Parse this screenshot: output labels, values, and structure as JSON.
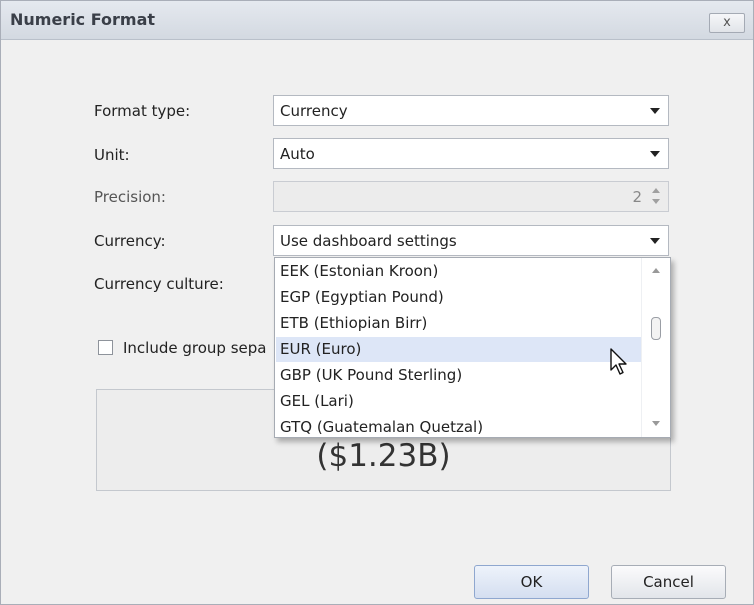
{
  "window": {
    "title": "Numeric Format",
    "close_glyph": "x"
  },
  "form": {
    "format_type": {
      "label": "Format type:",
      "value": "Currency"
    },
    "unit": {
      "label": "Unit:",
      "value": "Auto"
    },
    "precision": {
      "label": "Precision:",
      "value": "2",
      "disabled": true
    },
    "currency": {
      "label": "Currency:",
      "value": "Use dashboard settings"
    },
    "currency_culture": {
      "label": "Currency culture:"
    },
    "group_separator": {
      "label": "Include group sepa",
      "checked": false
    }
  },
  "dropdown": {
    "items": [
      {
        "label": "EEK (Estonian Kroon)"
      },
      {
        "label": "EGP (Egyptian Pound)"
      },
      {
        "label": "ETB (Ethiopian Birr)"
      },
      {
        "label": "EUR (Euro)",
        "highlighted": true
      },
      {
        "label": "GBP (UK Pound Sterling)"
      },
      {
        "label": "GEL (Lari)"
      },
      {
        "label": "GTQ (Guatemalan Quetzal)"
      }
    ]
  },
  "preview": {
    "text": "($1.23B)"
  },
  "buttons": {
    "ok": "OK",
    "cancel": "Cancel"
  },
  "colors": {
    "highlight": "#dde6f7",
    "titlebar": "#d3d9e1",
    "dialog_bg": "#f0f0f0"
  }
}
